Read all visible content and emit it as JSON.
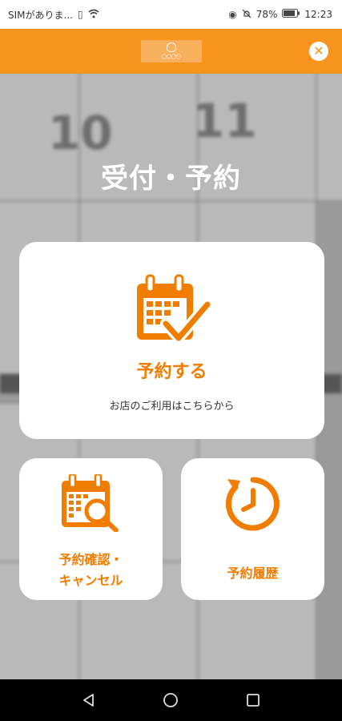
{
  "status_bar": {
    "carrier": "SIMがありま...",
    "battery": "78%",
    "time": "12:23"
  },
  "header": {
    "logo_text": "〇〇〇〇"
  },
  "page": {
    "title": "受付・予約"
  },
  "cards": {
    "reserve": {
      "label": "予約する",
      "sub": "お店のご利用はこちらから",
      "icon": "calendar-check-icon"
    },
    "confirm": {
      "label_line1": "予約確認・",
      "label_line2": "キャンセル",
      "icon": "calendar-search-icon"
    },
    "history": {
      "label": "予約履歴",
      "icon": "clock-history-icon"
    }
  },
  "background": {
    "day_numbers": [
      "10",
      "11"
    ]
  },
  "colors": {
    "accent": "#f7941d",
    "label": "#f07d00"
  }
}
